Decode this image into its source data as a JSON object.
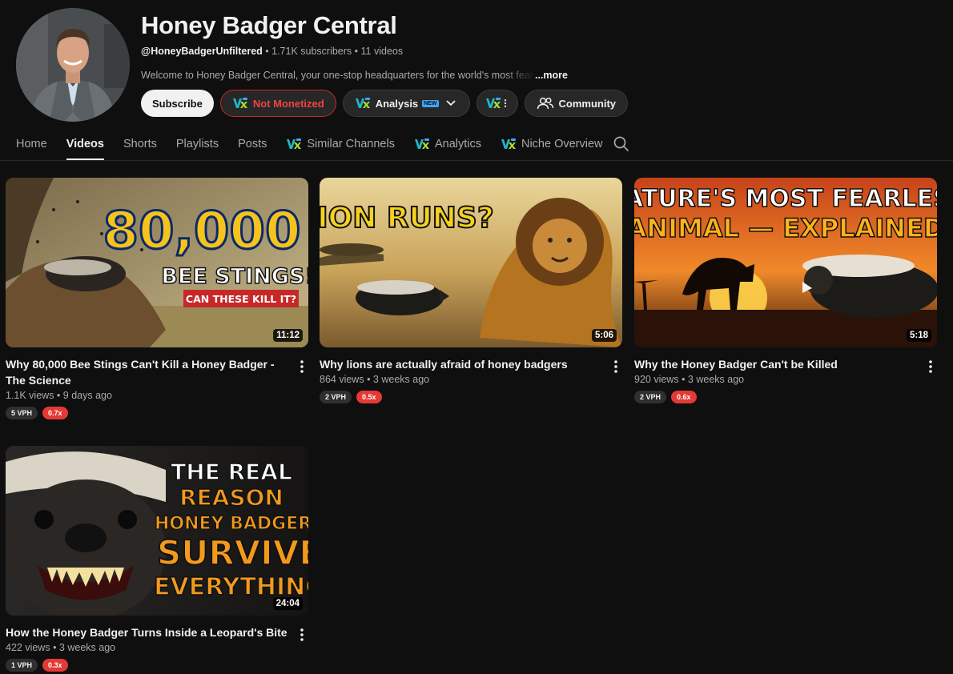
{
  "channel": {
    "title": "Honey Badger Central",
    "handle": "@HoneyBadgerUnfiltered",
    "sep1": " • ",
    "subscribers": "1.71K subscribers",
    "sep2": " • ",
    "video_count": "11 videos",
    "description": "Welcome to Honey Badger Central, your one-stop headquarters for the world's most fearl",
    "more_label": "...more"
  },
  "buttons": {
    "subscribe": "Subscribe",
    "not_monetized": "Not Monetized",
    "analysis": "Analysis",
    "new_badge": "NEW",
    "community": "Community"
  },
  "tabs": [
    {
      "label": "Home"
    },
    {
      "label": "Videos"
    },
    {
      "label": "Shorts"
    },
    {
      "label": "Playlists"
    },
    {
      "label": "Posts"
    },
    {
      "label": "Similar Channels"
    },
    {
      "label": "Analytics"
    },
    {
      "label": "Niche Overview"
    }
  ],
  "videos": [
    {
      "title": "Why 80,000 Bee Stings Can't Kill a Honey Badger -The Science",
      "views": "1.1K views",
      "sep": " • ",
      "age": "9 days ago",
      "duration": "11:12",
      "vph": "5 VPH",
      "ratio": "0.7x",
      "thumb_text": [
        "80,000",
        "BEE STINGS!",
        "CAN THESE KILL IT?"
      ]
    },
    {
      "title": "Why lions are actually afraid of honey badgers",
      "views": "864 views",
      "sep": " • ",
      "age": "3 weeks ago",
      "duration": "5:06",
      "vph": "2 VPH",
      "ratio": "0.5x",
      "thumb_text": [
        "LION RUNS?"
      ]
    },
    {
      "title": "Why the Honey Badger Can't be Killed",
      "views": "920 views",
      "sep": " • ",
      "age": "3 weeks ago",
      "duration": "5:18",
      "vph": "2 VPH",
      "ratio": "0.6x",
      "thumb_text": [
        "NATURE'S MOST FEARLESS",
        "ANIMAL — EXPLAINED"
      ]
    },
    {
      "title": "How the Honey Badger Turns Inside a Leopard's Bite",
      "views": "422 views",
      "sep": " • ",
      "age": "3 weeks ago",
      "duration": "24:04",
      "vph": "1 VPH",
      "ratio": "0.3x",
      "thumb_text": [
        "THE REAL",
        "REASON",
        "HONEY BADGERS",
        "SURVIVE",
        "EVERYTHING"
      ]
    }
  ],
  "icons": {
    "vx": "vidiq-icon",
    "search": "search-icon",
    "kebab": "more-vert-icon",
    "community": "people-icon",
    "chevron": "chevron-down-icon"
  },
  "colors": {
    "background": "#0f0f0f",
    "not_monetized": "#ef4444",
    "ratio_badge": "#e53935",
    "new_badge": "#3ea6ff"
  }
}
